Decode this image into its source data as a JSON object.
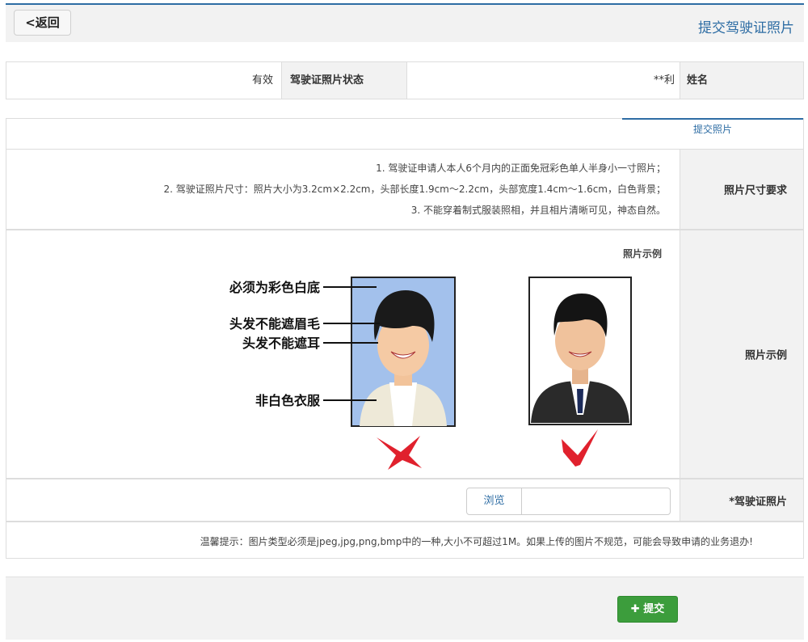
{
  "header": {
    "back_label": "<返回",
    "title": "提交驾驶证照片"
  },
  "info": {
    "name_label": "姓名",
    "name_value": "**利",
    "status_label": "驾驶证照片状态",
    "status_value": "有效"
  },
  "tabs": [
    {
      "label": "提交照片",
      "active": true
    }
  ],
  "requirements": {
    "label": "照片尺寸要求",
    "lines": [
      "1. 驾驶证申请人本人6个月内的正面免冠彩色单人半身小一寸照片；",
      "2. 驾驶证照片尺寸：照片大小为3.2cm×2.2cm，头部长度1.9cm～2.2cm，头部宽度1.4cm～1.6cm，白色背景；",
      "3. 不能穿着制式服装照相，并且相片清晰可见，神态自然。"
    ]
  },
  "example": {
    "label": "照片示例",
    "title": "照片示例",
    "annotations": [
      "必须为彩色白底",
      "头发不能遮眉毛",
      "头发不能遮耳",
      "非白色衣服"
    ],
    "colors": {
      "blue_bg": "#a3c1ec",
      "check": "#e0212d"
    }
  },
  "upload": {
    "label": "*驾驶证照片",
    "browse_label": "浏览",
    "file_value": ""
  },
  "notice": "温馨提示：图片类型必须是jpeg,jpg,png,bmp中的一种,大小不可超过1M。如果上传的图片不规范，可能会导致申请的业务退办!",
  "footer": {
    "submit_label": "✚ 提交"
  },
  "colors": {
    "accent": "#2e6da4",
    "success": "#3c9d3c",
    "label_bg": "#f2f2f2"
  }
}
